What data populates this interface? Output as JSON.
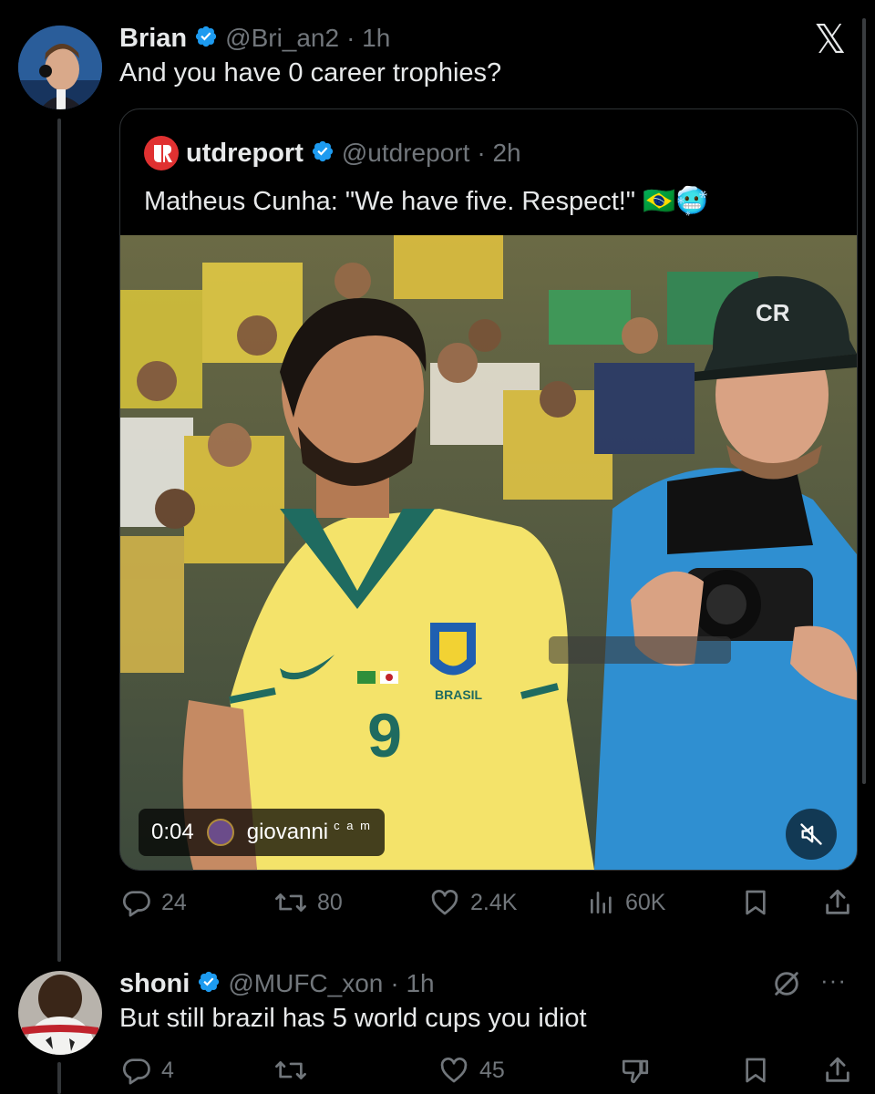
{
  "close_glyph": "𝕏",
  "tweet": {
    "author_name": "Brian",
    "handle": "@Bri_an2",
    "time": "· 1h",
    "text": "And you have 0 career trophies?"
  },
  "quote": {
    "author_name": "utdreport",
    "handle": "@utdreport",
    "time": "· 2h",
    "text": "Matheus Cunha: \"We have five. Respect!\" 🇧🇷🥶",
    "video": {
      "timestamp": "0:04",
      "creator": "giovanni",
      "creator_suffix": "c a m",
      "jersey_country": "BRASIL",
      "jersey_number": "9",
      "cap_logo": "CR"
    }
  },
  "tweet_actions": {
    "replies": "24",
    "reposts": "80",
    "likes": "2.4K",
    "views": "60K"
  },
  "reply": {
    "author_name": "shoni",
    "handle": "@MUFC_xon",
    "time": "· 1h",
    "text": "But still brazil has 5 world cups you idiot",
    "more": "···"
  },
  "reply_actions": {
    "replies": "4",
    "reposts": "",
    "likes": "45"
  },
  "colors": {
    "background": "#000000",
    "text_primary": "#e7e9ea",
    "text_secondary": "#71767b",
    "verified": "#1d9bf0",
    "border": "#2f3336"
  }
}
